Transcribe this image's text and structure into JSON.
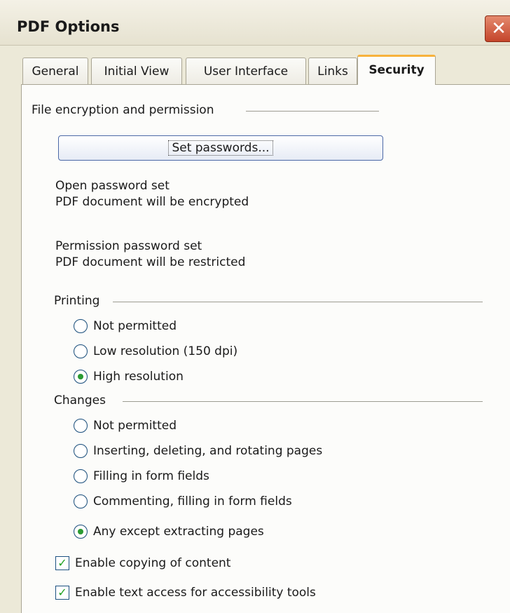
{
  "window": {
    "title": "PDF Options",
    "close_glyph": "✕"
  },
  "tabs": [
    {
      "label": "General"
    },
    {
      "label": "Initial View"
    },
    {
      "label": "User Interface"
    },
    {
      "label": "Links"
    },
    {
      "label": "Security",
      "active": true
    }
  ],
  "security": {
    "encryption_group": "File encryption and permission",
    "set_passwords_button": "Set passwords...",
    "open_status_line1": "Open password set",
    "open_status_line2": "PDF document will be encrypted",
    "perm_status_line1": "Permission password set",
    "perm_status_line2": "PDF document will be restricted",
    "printing": {
      "label": "Printing",
      "options": [
        "Not permitted",
        "Low resolution (150 dpi)",
        "High resolution"
      ],
      "selected": "High resolution"
    },
    "changes": {
      "label": "Changes",
      "options": [
        "Not permitted",
        "Inserting, deleting, and rotating pages",
        "Filling in form fields",
        "Commenting, filling in form fields",
        "Any except extracting pages"
      ],
      "selected": "Any except extracting pages"
    },
    "checkboxes": [
      {
        "label": "Enable copying of content",
        "checked": true
      },
      {
        "label": "Enable text access for accessibility tools",
        "checked": true
      }
    ]
  },
  "icons": {
    "close": "close-icon",
    "check": "checkmark-icon"
  },
  "colors": {
    "active_tab_accent": "#f7b23c",
    "radio_dot": "#2a9a32",
    "check_mark": "#21a121"
  }
}
